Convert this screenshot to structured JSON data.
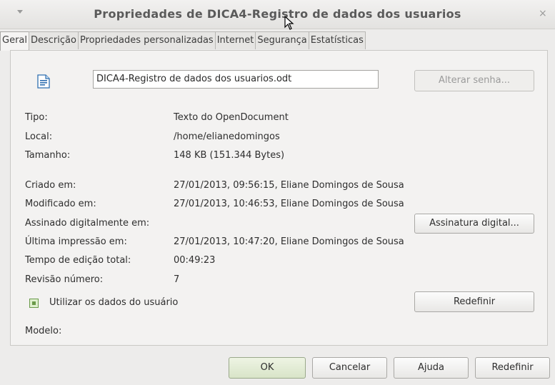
{
  "window": {
    "title": "Propriedades de DICA4-Registro de dados dos usuarios",
    "menu_icon": "chevron-down-icon",
    "close_icon": "×"
  },
  "tabs": [
    {
      "label": "Geral"
    },
    {
      "label": "Descrição"
    },
    {
      "label": "Propriedades personalizadas"
    },
    {
      "label": "Internet"
    },
    {
      "label": "Segurança"
    },
    {
      "label": "Estatísticas"
    }
  ],
  "general": {
    "file_name": "DICA4-Registro de dados dos usuarios.odt",
    "change_password_label": "Alterar senha...",
    "type_label": "Tipo:",
    "type_value": "Texto do OpenDocument",
    "location_label": "Local:",
    "location_value": "/home/elianedomingos",
    "size_label": "Tamanho:",
    "size_value": "148 KB (151.344 Bytes)",
    "created_label": "Criado em:",
    "created_value": "27/01/2013, 09:56:15, Eliane Domingos de Sousa",
    "modified_label": "Modificado em:",
    "modified_value": "27/01/2013, 10:46:53, Eliane Domingos de Sousa",
    "signed_label": "Assinado digitalmente em:",
    "digital_signature_button": "Assinatura digital...",
    "printed_label": "Última impressão em:",
    "printed_value": "27/01/2013, 10:47:20, Eliane Domingos de Sousa",
    "edit_time_label": "Tempo de edição total:",
    "edit_time_value": "00:49:23",
    "revision_label": "Revisão número:",
    "revision_value": "7",
    "use_user_data_label": "Utilizar os dados do usuário",
    "use_user_data_checked": true,
    "reset_label": "Redefinir",
    "template_label": "Modelo:"
  },
  "footer": {
    "ok": "OK",
    "cancel": "Cancelar",
    "help": "Ajuda",
    "reset": "Redefinir"
  }
}
